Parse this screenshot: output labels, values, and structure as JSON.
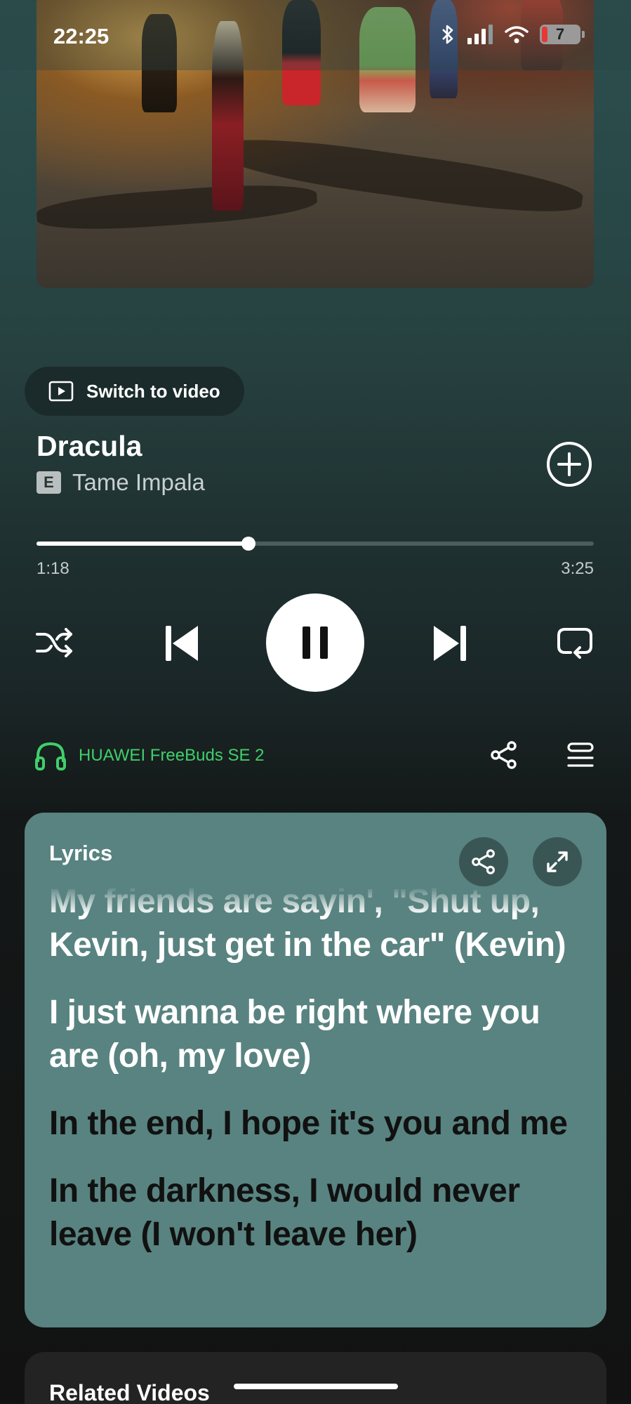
{
  "status_bar": {
    "time": "22:25",
    "battery_level": "7"
  },
  "player": {
    "switch_video_label": "Switch to video",
    "track_title": "Dracula",
    "explicit_badge": "E",
    "artist": "Tame Impala",
    "elapsed": "1:18",
    "duration": "3:25",
    "progress_fraction": 0.38,
    "device_name": "HUAWEI FreeBuds SE 2"
  },
  "lyrics": {
    "header": "Lyrics",
    "lines": [
      {
        "text": "My friends are sayin', \"Shut up, Kevin, just get in the car\" (Kevin)",
        "state": "past"
      },
      {
        "text": "I just wanna be right where you are (oh, my love)",
        "state": "past"
      },
      {
        "text": "In the end, I hope it's you and me",
        "state": "future"
      },
      {
        "text": "In the darkness, I would never leave (I won't leave her)",
        "state": "future"
      }
    ]
  },
  "related": {
    "header": "Related Videos"
  },
  "colors": {
    "accent_green": "#3fcf6a",
    "lyrics_card": "#588380"
  }
}
